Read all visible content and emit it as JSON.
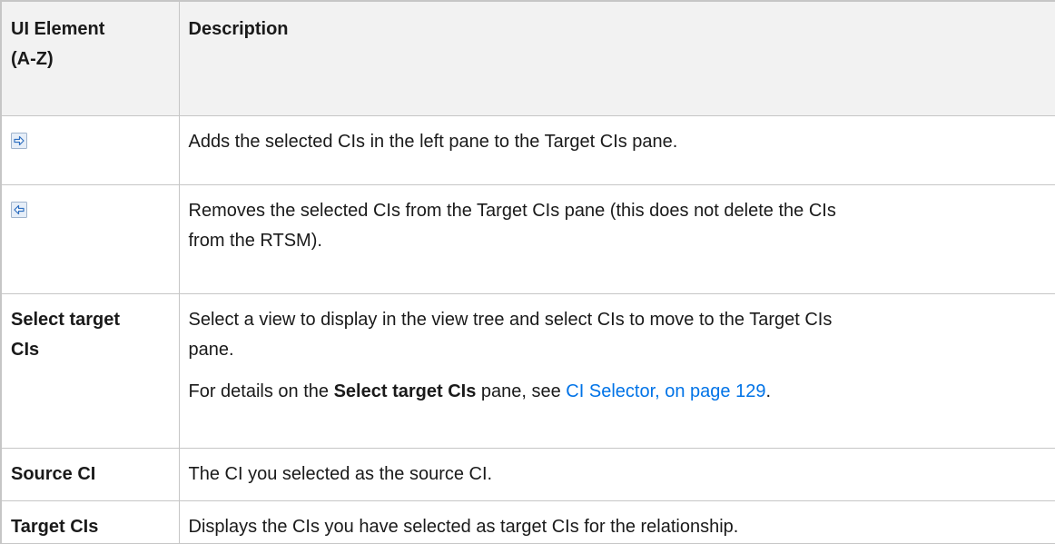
{
  "table": {
    "header": {
      "col1_line1": "UI Element",
      "col1_line2": "(A-Z)",
      "col2": "Description"
    },
    "rows": [
      {
        "icon": "arrow-right-icon",
        "description": "Adds the selected CIs in the left pane to the Target CIs pane."
      },
      {
        "icon": "arrow-left-icon",
        "description_line1": "Removes the selected CIs from the Target CIs pane (this does not delete the CIs",
        "description_line2": "from the RTSM)."
      },
      {
        "name_line1": "Select target",
        "name_line2": "CIs",
        "description_line1": "Select a view to display in the view tree and select CIs to move to the Target CIs",
        "description_line2": "pane.",
        "detail_prefix": "For details on the ",
        "detail_bold": "Select target CIs",
        "detail_middle": " pane, see ",
        "detail_link": "CI Selector, on page 129",
        "detail_suffix": "."
      },
      {
        "name": "Source CI",
        "description": "The CI you selected as the source CI."
      },
      {
        "name": "Target CIs",
        "description": "Displays the CIs you have selected as target CIs for the relationship."
      }
    ]
  },
  "colors": {
    "header_bg": "#f2f2f2",
    "border": "#c6c6c6",
    "link": "#0073e7",
    "icon_fill": "#e6eef8",
    "icon_arrow": "#2f6fc0"
  }
}
